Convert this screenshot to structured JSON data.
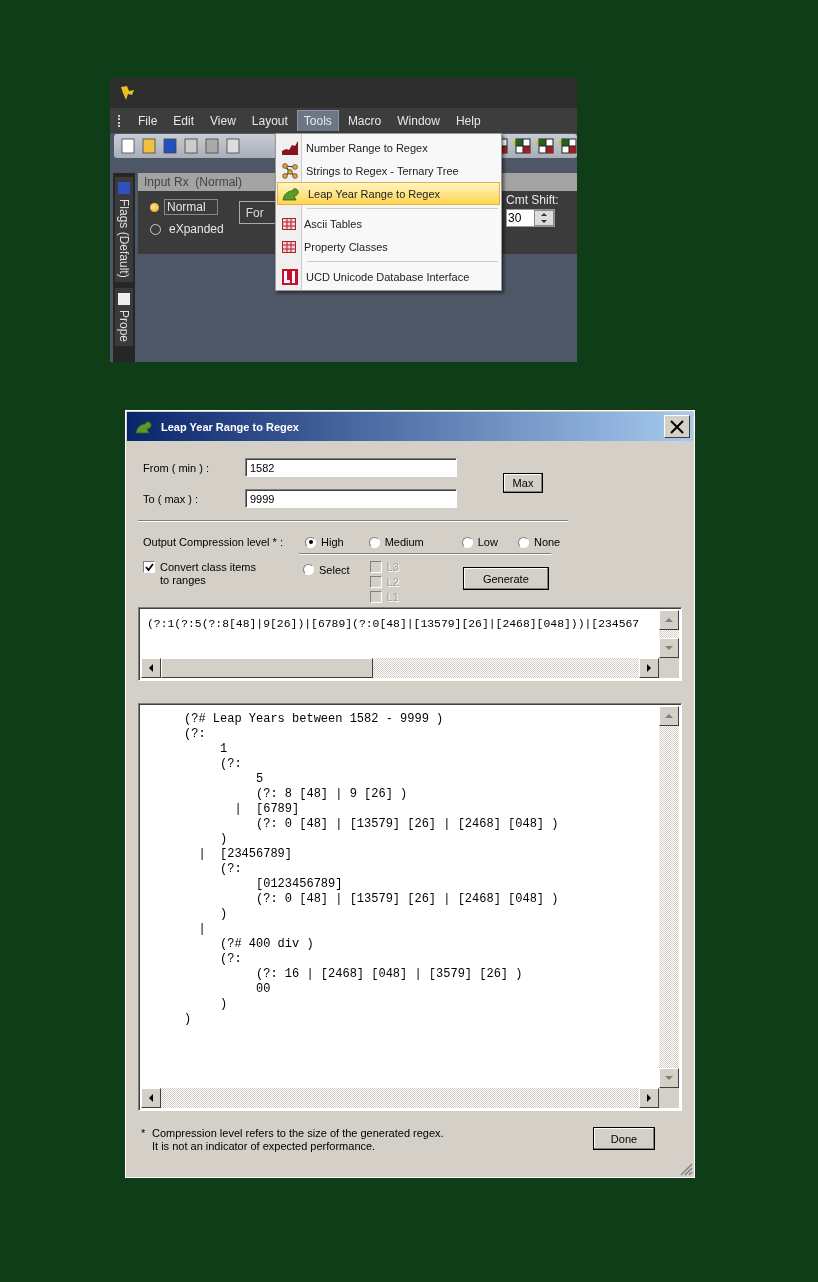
{
  "app": {
    "menu": [
      {
        "label": "File",
        "selected": false
      },
      {
        "label": "Edit",
        "selected": false
      },
      {
        "label": "View",
        "selected": false
      },
      {
        "label": "Layout",
        "selected": false
      },
      {
        "label": "Tools",
        "selected": true
      },
      {
        "label": "Macro",
        "selected": false
      },
      {
        "label": "Window",
        "selected": false
      },
      {
        "label": "Help",
        "selected": false
      }
    ],
    "dropdown": [
      [
        {
          "label": "Number Range to Regex",
          "selected": false
        },
        {
          "label": "Strings to Regex - Ternary Tree",
          "selected": false
        },
        {
          "label": "Leap Year Range to Regex",
          "selected": true
        }
      ],
      [
        {
          "label": "Ascii Tables",
          "selected": false
        },
        {
          "label": "Property Classes",
          "selected": false
        }
      ],
      [
        {
          "label": "UCD  Unicode Database Interface",
          "selected": false
        }
      ]
    ],
    "side_tabs": [
      "Flags (Default)",
      "Prope"
    ],
    "panel": {
      "title": "Input Rx  (Normal)",
      "modes": [
        {
          "label": "Normal",
          "selected": true
        },
        {
          "label": "eXpanded",
          "selected": false
        }
      ],
      "button": "For",
      "cmt_label": "Cmt Shift:",
      "cmt_value": "30"
    }
  },
  "dialog": {
    "title": "Leap Year Range to Regex",
    "from": {
      "label": "From ( min ) :",
      "value": "1582"
    },
    "to": {
      "label": "To ( max ) :",
      "value": "9999"
    },
    "max_button": "Max",
    "compression_label": "Output Compression level * :",
    "compression_options": [
      {
        "label": "High",
        "selected": true
      },
      {
        "label": "Medium",
        "selected": false
      },
      {
        "label": "Low",
        "selected": false
      },
      {
        "label": "None",
        "selected": false
      }
    ],
    "convert": {
      "label": "Convert class items\nto ranges",
      "checked": true
    },
    "select_option": {
      "label": "Select",
      "selected": false
    },
    "levels": [
      {
        "label": "L3",
        "checked": false,
        "disabled": true
      },
      {
        "label": "L2",
        "checked": false,
        "disabled": true
      },
      {
        "label": "L1",
        "checked": false,
        "disabled": true
      }
    ],
    "generate_button": "Generate",
    "regex": "(?:1(?:5(?:8[48]|9[26])|[6789](?:0[48]|[13579][26]|[2468][048]))|[234567",
    "formatted": [
      "     (?# Leap Years between 1582 - 9999 )",
      "     (?:",
      "          1",
      "          (?:",
      "               5",
      "               (?: 8 [48] | 9 [26] )",
      "            |  [6789]",
      "               (?: 0 [48] | [13579] [26] | [2468] [048] )",
      "          )",
      "       |  [23456789]",
      "          (?:",
      "               [0123456789]",
      "               (?: 0 [48] | [13579] [26] | [2468] [048] )",
      "          )",
      "       |",
      "          (?# 400 div )",
      "          (?:",
      "               (?: 16 | [2468] [048] | [3579] [26] )",
      "               00",
      "          )",
      "     )"
    ],
    "footnote_mark": "*",
    "footnote": "Compression level refers to the size of the generated regex.\nIt is not an indicator of expected performance.",
    "done_button": "Done"
  }
}
